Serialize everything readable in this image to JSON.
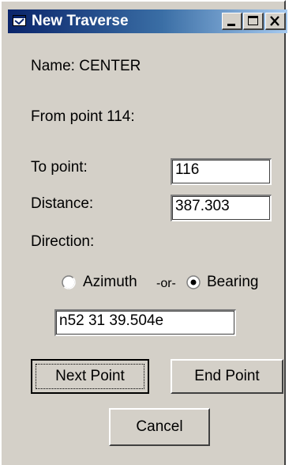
{
  "window": {
    "title": "New Traverse",
    "icon": "app-window-icon",
    "controls": {
      "minimize_icon": "minimize-icon",
      "maximize_icon": "maximize-icon",
      "close_icon": "close-icon"
    }
  },
  "info": {
    "name_line": "Name: CENTER",
    "from_line": "From point 114:"
  },
  "fields": {
    "to_point_label": "To point:",
    "to_point_value": "116",
    "distance_label": "Distance:",
    "distance_value": "387.303",
    "direction_label": "Direction:",
    "direction_value": "n52 31 39.504e"
  },
  "direction_mode": {
    "azimuth_label": "Azimuth",
    "or_label": "-or-",
    "bearing_label": "Bearing",
    "selected": "Bearing"
  },
  "buttons": {
    "next_point": "Next Point",
    "end_point": "End Point",
    "cancel": "Cancel"
  },
  "colors": {
    "titlebar_start": "#0a246a",
    "titlebar_end": "#a6caf0",
    "face": "#d4d0c8"
  }
}
